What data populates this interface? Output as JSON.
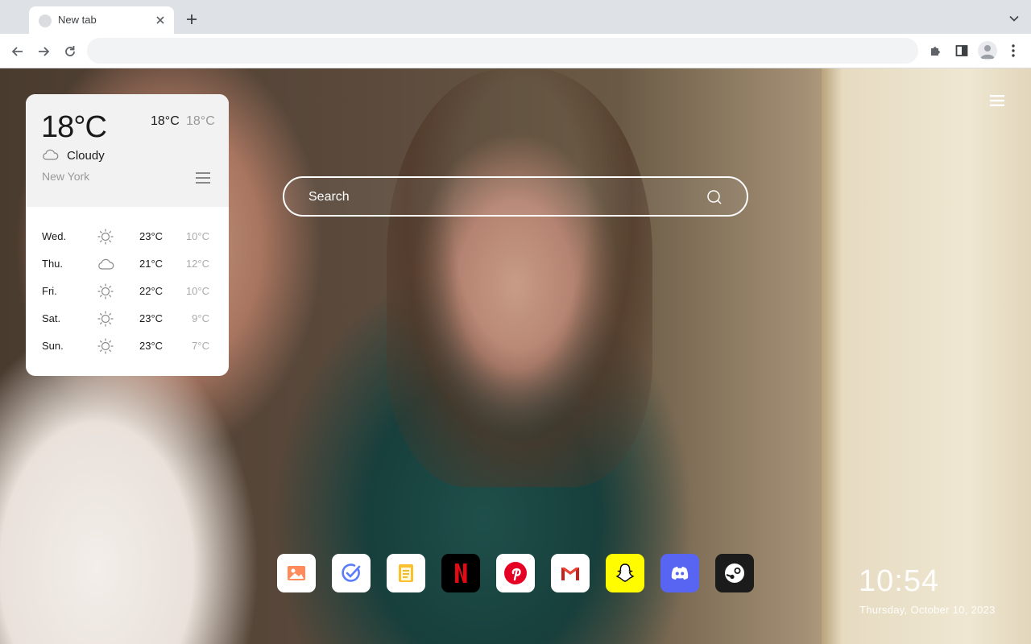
{
  "browser": {
    "tab_title": "New tab",
    "omnibox_value": ""
  },
  "weather": {
    "current_temp": "18°C",
    "high": "18°C",
    "low": "18°C",
    "condition": "Cloudy",
    "condition_icon": "cloud-icon",
    "city": "New York",
    "forecast": [
      {
        "day": "Wed.",
        "icon": "sun-icon",
        "high": "23°C",
        "low": "10°C"
      },
      {
        "day": "Thu.",
        "icon": "cloud-icon",
        "high": "21°C",
        "low": "12°C"
      },
      {
        "day": "Fri.",
        "icon": "sun-icon",
        "high": "22°C",
        "low": "10°C"
      },
      {
        "day": "Sat.",
        "icon": "sun-icon",
        "high": "23°C",
        "low": "9°C"
      },
      {
        "day": "Sun.",
        "icon": "sun-icon",
        "high": "23°C",
        "low": "7°C"
      }
    ]
  },
  "search": {
    "placeholder": "Search"
  },
  "dock": {
    "apps": [
      {
        "name": "gallery",
        "icon": "image-gallery-icon",
        "bg": "#ffffff"
      },
      {
        "name": "tasks",
        "icon": "check-circle-icon",
        "bg": "#ffffff"
      },
      {
        "name": "notes",
        "icon": "notes-icon",
        "bg": "#ffffff"
      },
      {
        "name": "netflix",
        "icon": "netflix-icon",
        "bg": "#000000"
      },
      {
        "name": "pinterest",
        "icon": "pinterest-icon",
        "bg": "#ffffff"
      },
      {
        "name": "gmail",
        "icon": "gmail-icon",
        "bg": "#ffffff"
      },
      {
        "name": "snapchat",
        "icon": "snapchat-icon",
        "bg": "#fffc00"
      },
      {
        "name": "discord",
        "icon": "discord-icon",
        "bg": "#5865f2"
      },
      {
        "name": "steam",
        "icon": "steam-icon",
        "bg": "#1b1b1b"
      }
    ]
  },
  "clock": {
    "time": "10:54",
    "date": "Thursday, October 10, 2023"
  }
}
